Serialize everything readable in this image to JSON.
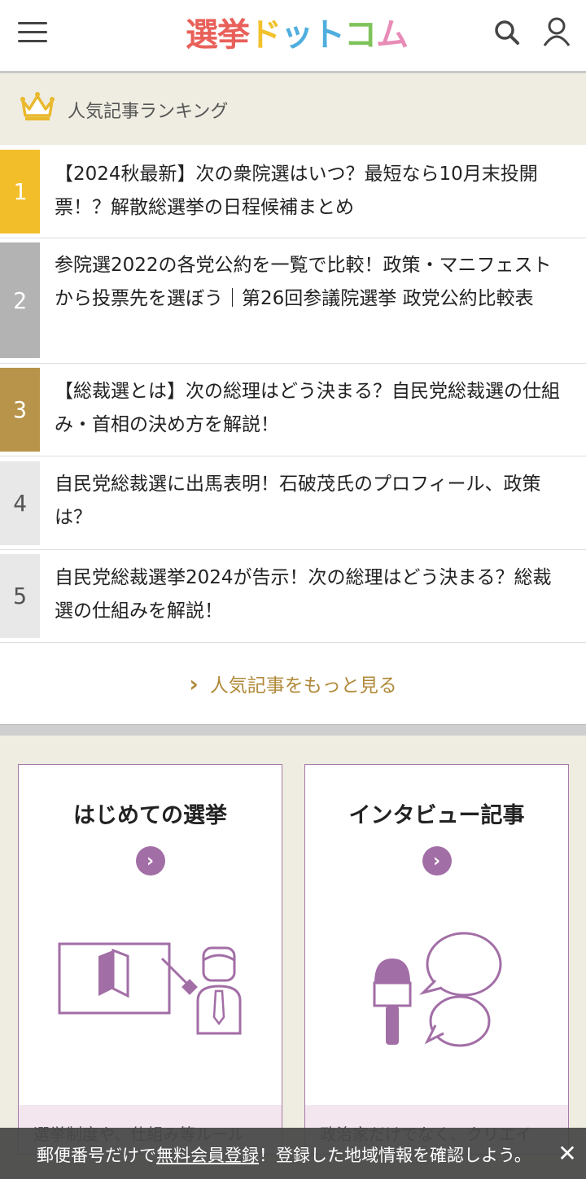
{
  "header": {
    "logo_chars": [
      {
        "char": "選",
        "color": "#e9605a"
      },
      {
        "char": "挙",
        "color": "#e9605a"
      },
      {
        "char": "ド",
        "color": "#f2c12b"
      },
      {
        "char": "ッ",
        "color": "#4eaede"
      },
      {
        "char": "ト",
        "color": "#4eaede"
      },
      {
        "char": "コ",
        "color": "#7fc35a"
      },
      {
        "char": "ム",
        "color": "#e98bb7"
      }
    ],
    "menu_icon": "hamburger-menu-icon",
    "search_icon": "search-icon",
    "user_icon": "user-icon"
  },
  "ranking": {
    "title": "人気記事ランキング",
    "crown_icon": "crown-icon",
    "crown_color": "#e9b92e",
    "items": [
      {
        "rank": "1",
        "text": "【2024秋最新】次の衆院選はいつ？最短なら10月末投開票！？解散総選挙の日程候補まとめ",
        "badge_color": "#f2bf2b",
        "num_color": "#fff"
      },
      {
        "rank": "2",
        "text": "参院選2022の各党公約を一覧で比較！政策・マニフェストから投票先を選ぼう｜第26回参議院選挙 政党公約比較表",
        "badge_color": "#b3b3b3",
        "num_color": "#fff"
      },
      {
        "rank": "3",
        "text": "【総裁選とは】次の総理はどう決まる？自民党総裁選の仕組み・首相の決め方を解説！",
        "badge_color": "#b8944a",
        "num_color": "#fff"
      },
      {
        "rank": "4",
        "text": "自民党総裁選に出馬表明！石破茂氏のプロフィール、政策は？",
        "badge_color": "#e8e8e8",
        "num_color": "#555"
      },
      {
        "rank": "5",
        "text": "自民党総裁選挙2024が告示！次の総理はどう決まる？総裁選の仕組みを解説！",
        "badge_color": "#e8e8e8",
        "num_color": "#555"
      }
    ],
    "more_label": "人気記事をもっと見る"
  },
  "cards": [
    {
      "title": "はじめての選挙",
      "footer": "選挙制度や、仕組み等ルール",
      "illustration": "beginner-lecture-icon"
    },
    {
      "title": "インタビュー記事",
      "footer": "政治家だけでなく、クリエイ",
      "illustration": "microphone-speech-icon"
    }
  ],
  "banner": {
    "prefix": "郵便番号だけで",
    "link": "無料会員登録",
    "suffix": "！登録した地域情報を確認しよう。",
    "close": "✕"
  },
  "colors": {
    "accent_gold": "#b08a3a",
    "card_purple": "#a26ea6"
  }
}
